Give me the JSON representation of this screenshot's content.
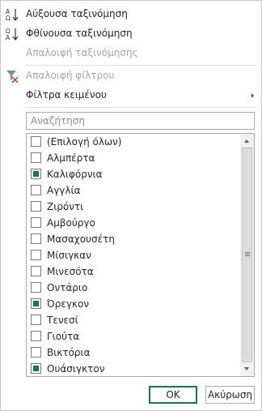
{
  "menu": {
    "sort_asc": "Αύξουσα ταξινόμηση",
    "sort_desc": "Φθίνουσα ταξινόμηση",
    "clear_sort": "Απαλοιφή ταξινόμησης",
    "clear_filter": "Απαλοιφή φίλτρου",
    "text_filters": "Φίλτρα κειμένου"
  },
  "search": {
    "placeholder": "Αναζήτηση",
    "value": ""
  },
  "list": {
    "items": [
      {
        "label": "(Επιλογή όλων)",
        "checked": false
      },
      {
        "label": "Αλμπέρτα",
        "checked": false
      },
      {
        "label": "Καλιφόρνια",
        "checked": true
      },
      {
        "label": "Αγγλία",
        "checked": false
      },
      {
        "label": "Ζιρόντι",
        "checked": false
      },
      {
        "label": "Αμβούργο",
        "checked": false
      },
      {
        "label": "Μασαχουσέτη",
        "checked": false
      },
      {
        "label": "Μίσιγκαν",
        "checked": false
      },
      {
        "label": "Μινεσότα",
        "checked": false
      },
      {
        "label": "Οντάριο",
        "checked": false
      },
      {
        "label": "Όρεγκον",
        "checked": true
      },
      {
        "label": "Τενεσί",
        "checked": false
      },
      {
        "label": "Γιούτα",
        "checked": false
      },
      {
        "label": "Βικτόρια",
        "checked": false
      },
      {
        "label": "Ουάσιγκτον",
        "checked": true
      }
    ]
  },
  "buttons": {
    "ok": "OK",
    "cancel": "Ακύρωση"
  },
  "colors": {
    "accent": "#217346",
    "clear_filter_x": "#e04a2f"
  }
}
